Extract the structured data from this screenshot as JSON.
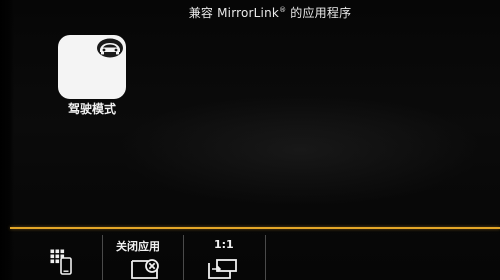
{
  "header": {
    "title_prefix": "兼容 MirrorLink",
    "title_reg": "®",
    "title_suffix": " 的应用程序"
  },
  "apps": [
    {
      "label": "驾驶模式",
      "icon": "car-icon"
    }
  ],
  "toolbar": {
    "home": {
      "icon": "app-grid-phone-icon",
      "label": ""
    },
    "close_app": {
      "label": "关闭应用",
      "icon": "close-app-icon"
    },
    "ratio": {
      "label": "1:1",
      "icon": "screen-ratio-icon"
    }
  },
  "colors": {
    "accent_line": "#e3a628",
    "text": "#f0f0f0",
    "background": "#050505",
    "tile": "#f4f4f4"
  }
}
